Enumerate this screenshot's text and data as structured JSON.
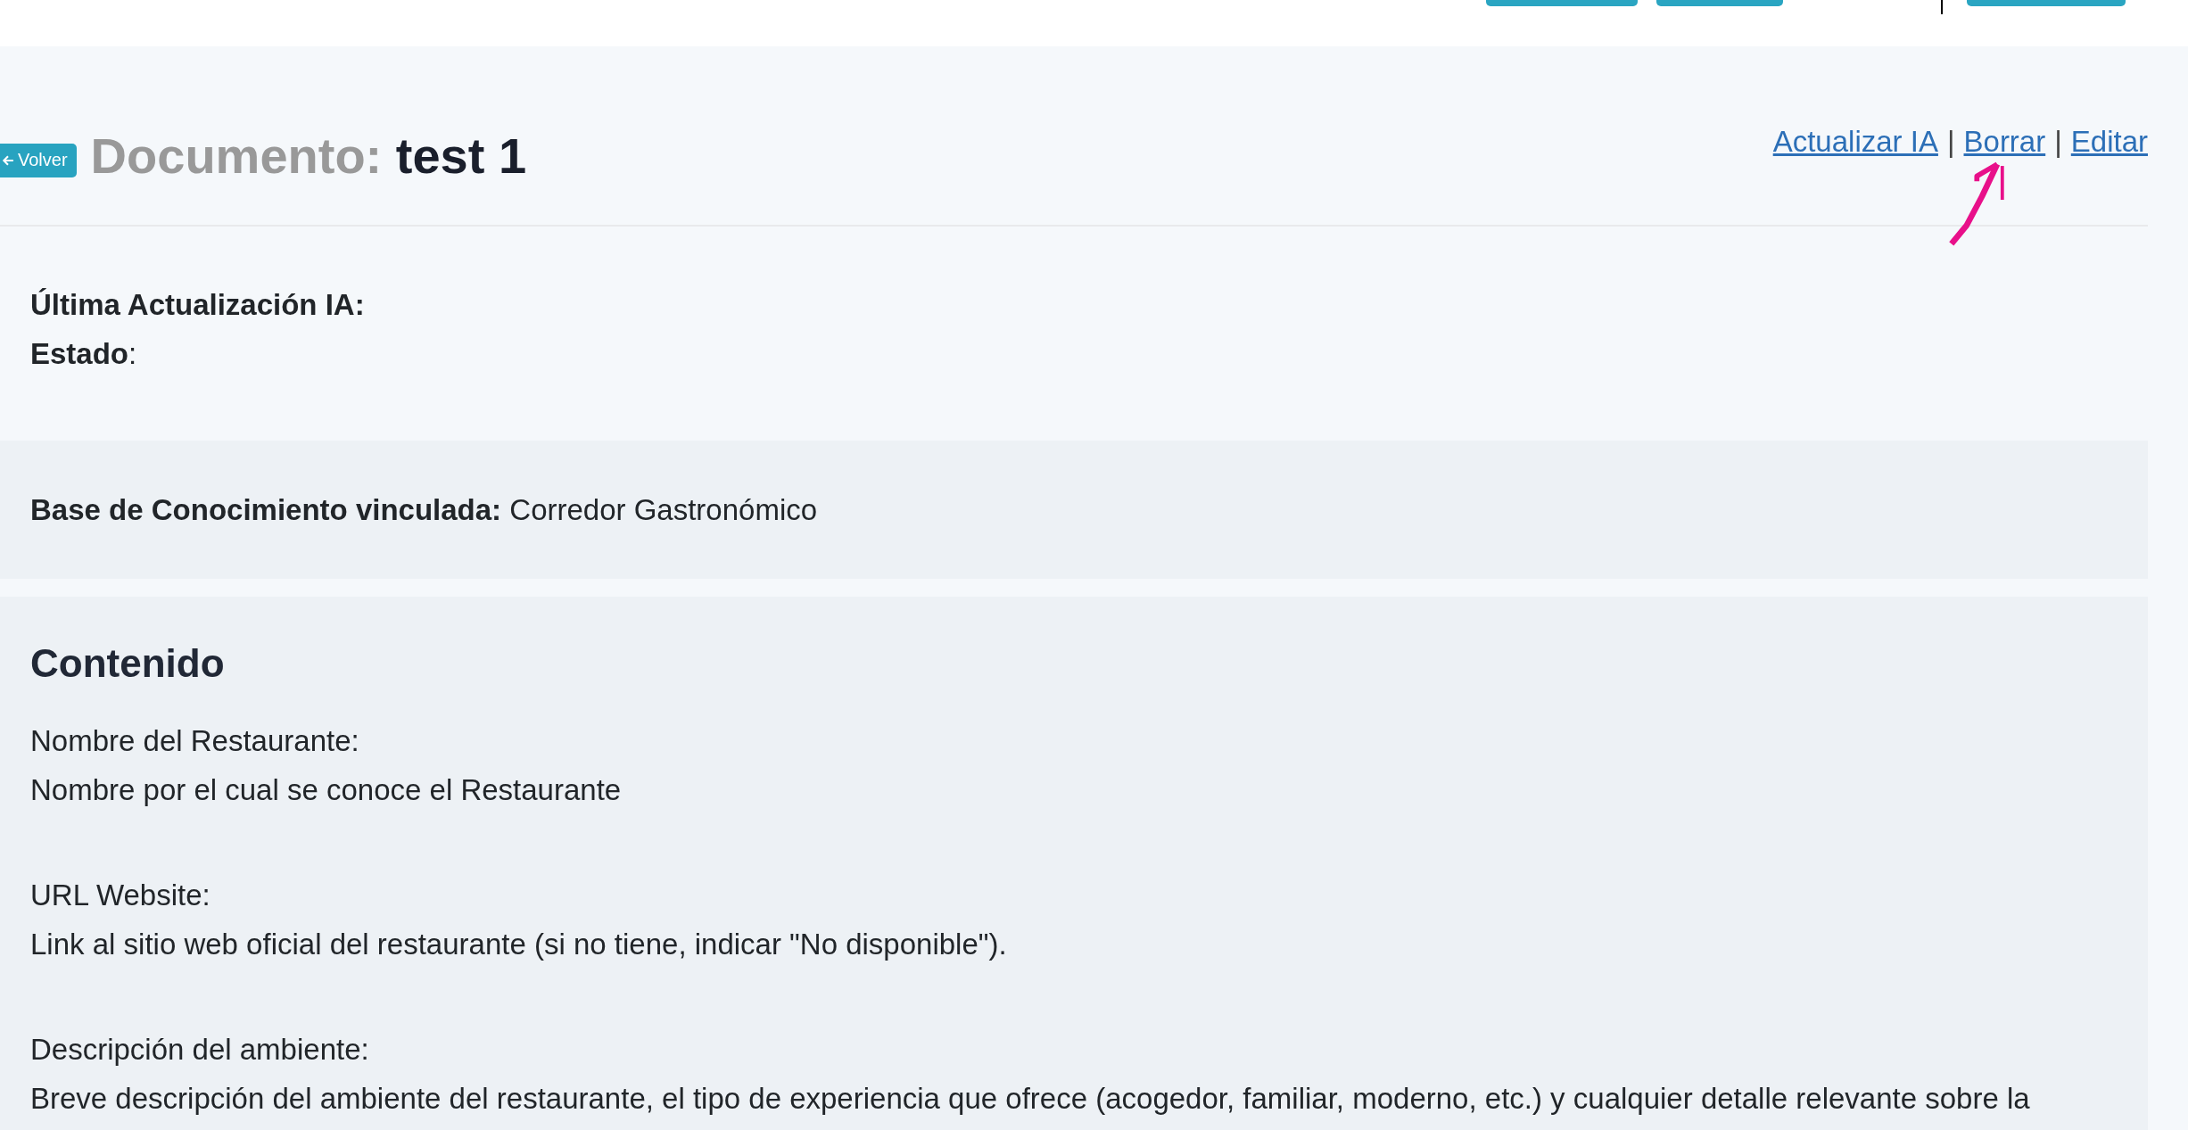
{
  "header_controls": [
    {
      "kind": "button"
    },
    {
      "kind": "button"
    },
    {
      "kind": "cursor"
    },
    {
      "kind": "button"
    }
  ],
  "back_button": {
    "label": "Volver"
  },
  "title": {
    "prefix": "Documento:",
    "name": "test 1"
  },
  "actions": [
    {
      "kind": "link",
      "label": "Actualizar IA"
    },
    {
      "kind": "separator",
      "label": "|"
    },
    {
      "kind": "link",
      "label": "Borrar"
    },
    {
      "kind": "separator",
      "label": "|"
    },
    {
      "kind": "link",
      "label": "Editar"
    }
  ],
  "annotation": {
    "kind": "arrow"
  },
  "meta": [
    "**Última Actualización IA:**",
    "**Estado**:"
  ],
  "knowledge_base": "**Base de Conocimiento vinculada:** Corredor Gastronómico",
  "content": {
    "heading": "Contenido",
    "fields": [
      {
        "label": "Nombre del Restaurante:",
        "description": "Nombre por el cual se conoce el Restaurante"
      },
      {
        "label": "URL Website:",
        "description": "Link al sitio web oficial del restaurante (si no tiene, indicar \"No disponible\")."
      },
      {
        "label": "Descripción del ambiente:",
        "description": "Breve descripción del ambiente del restaurante, el tipo de experiencia que ofrece (acogedor, familiar, moderno, etc.) y cualquier detalle relevante sobre la"
      }
    ]
  }
}
